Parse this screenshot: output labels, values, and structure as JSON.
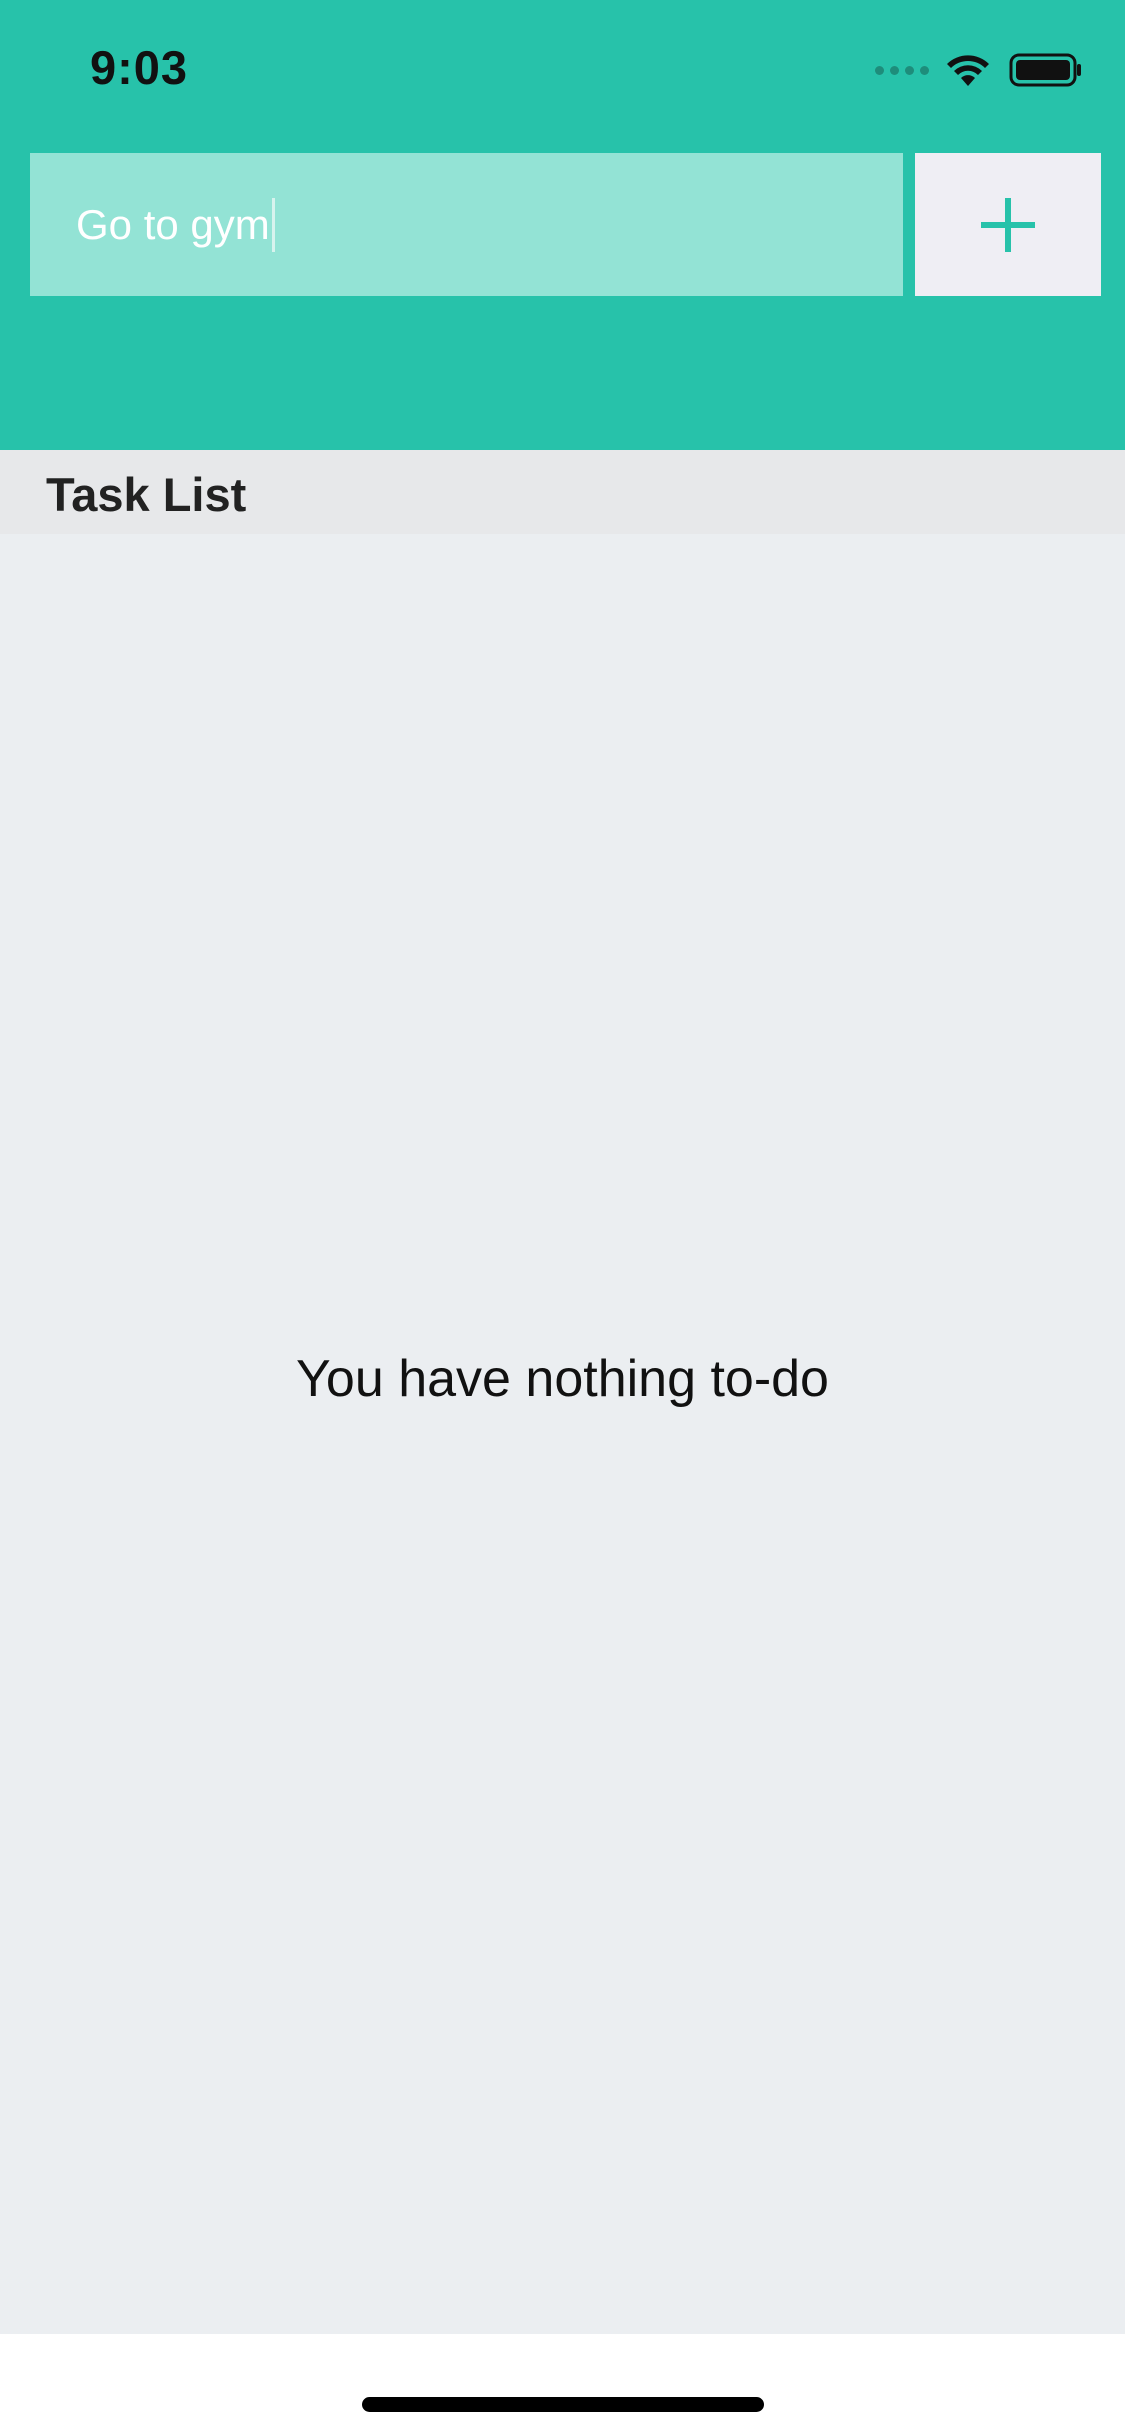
{
  "status_bar": {
    "time": "9:03"
  },
  "task_form": {
    "input_value": "Go to gym",
    "add_button_icon": "plus-icon"
  },
  "task_list": {
    "title": "Task List",
    "empty_message": "You have nothing to-do"
  },
  "colors": {
    "accent": "#27c2aa",
    "input_background": "#93e3d5",
    "button_background": "#efeef4",
    "list_background": "#ebeef1"
  }
}
